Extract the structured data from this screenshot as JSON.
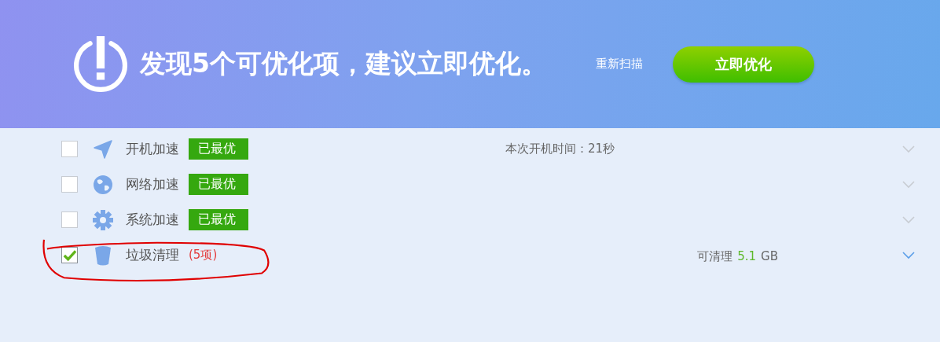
{
  "header": {
    "title": "发现5个可优化项，建议立即优化。",
    "rescan": "重新扫描",
    "optimize_button": "立即优化"
  },
  "items": [
    {
      "kind": "rocket",
      "label": "开机加速",
      "checked": false,
      "status": {
        "kind": "badge",
        "text": "已最优"
      },
      "info": {
        "kind": "time",
        "text": "本次开机时间：21秒"
      }
    },
    {
      "kind": "globe",
      "label": "网络加速",
      "checked": false,
      "status": {
        "kind": "badge",
        "text": "已最优"
      }
    },
    {
      "kind": "gear",
      "label": "系统加速",
      "checked": false,
      "status": {
        "kind": "badge",
        "text": "已最优"
      }
    },
    {
      "kind": "bin",
      "label": "垃圾清理",
      "checked": true,
      "status": {
        "kind": "count",
        "text": "(5项)"
      },
      "info": {
        "kind": "size",
        "text": "可清理",
        "value": "5.1",
        "unit": "GB"
      }
    }
  ]
}
